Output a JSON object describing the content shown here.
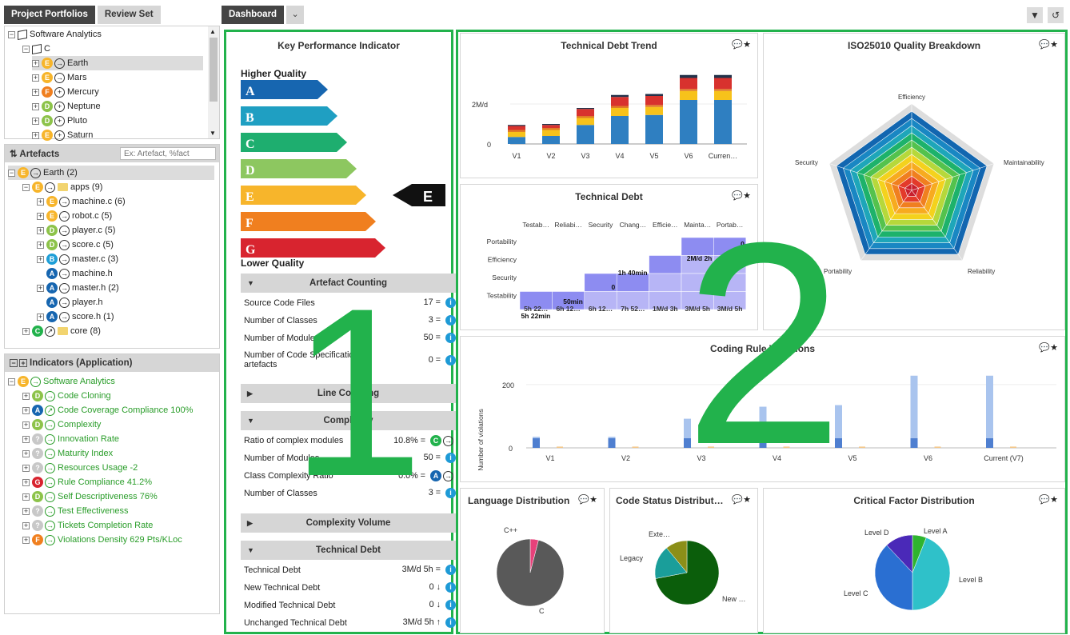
{
  "tabs": {
    "project_portfolios": "Project Portfolios",
    "review_set": "Review Set",
    "dashboard": "Dashboard"
  },
  "portfolio_tree": [
    {
      "label": "Software Analytics",
      "pm": "−",
      "icon": "cube"
    },
    {
      "label": "C",
      "pm": "−",
      "icon": "cube"
    },
    {
      "label": "Earth",
      "pm": "+",
      "badge": "E",
      "arrow": "→",
      "selected": true
    },
    {
      "label": "Mars",
      "pm": "+",
      "badge": "E",
      "arrow": "→"
    },
    {
      "label": "Mercury",
      "pm": "+",
      "badge": "F",
      "arrow": "+"
    },
    {
      "label": "Neptune",
      "pm": "+",
      "badge": "D",
      "arrow": "+"
    },
    {
      "label": "Pluto",
      "pm": "+",
      "badge": "D",
      "arrow": "+"
    },
    {
      "label": "Saturn",
      "pm": "+",
      "badge": "E",
      "arrow": "+"
    }
  ],
  "artefacts": {
    "title": "Artefacts",
    "search_placeholder": "Ex: Artefact, %fact",
    "items": [
      {
        "label": "Earth (2)",
        "pm": "−",
        "badge": "E",
        "indent": 0,
        "folder": false,
        "selected": true
      },
      {
        "label": "apps (9)",
        "pm": "−",
        "badge": "E",
        "indent": 1,
        "folder": true
      },
      {
        "label": "machine.c (6)",
        "pm": "+",
        "badge": "E",
        "indent": 2
      },
      {
        "label": "robot.c (5)",
        "pm": "+",
        "badge": "E",
        "indent": 2
      },
      {
        "label": "player.c (5)",
        "pm": "+",
        "badge": "D",
        "indent": 2
      },
      {
        "label": "score.c (5)",
        "pm": "+",
        "badge": "D",
        "indent": 2
      },
      {
        "label": "master.c (3)",
        "pm": "+",
        "badge": "B",
        "indent": 2
      },
      {
        "label": "machine.h",
        "pm": "",
        "badge": "A",
        "indent": 2
      },
      {
        "label": "master.h (2)",
        "pm": "+",
        "badge": "A",
        "indent": 2
      },
      {
        "label": "player.h",
        "pm": "",
        "badge": "A",
        "indent": 2
      },
      {
        "label": "score.h (1)",
        "pm": "+",
        "badge": "A",
        "indent": 2
      },
      {
        "label": "core (8)",
        "pm": "+",
        "badge": "C",
        "indent": 1,
        "folder": true,
        "arrow": "↗"
      }
    ]
  },
  "indicators": {
    "title": "Indicators (Application)",
    "items": [
      {
        "label": "Software Analytics",
        "pm": "−",
        "badge": "E",
        "indent": 0
      },
      {
        "label": "Code Cloning",
        "badge": "D"
      },
      {
        "label": "Code Coverage Compliance 100%",
        "badge": "A",
        "arrow": "↗"
      },
      {
        "label": "Complexity",
        "badge": "D"
      },
      {
        "label": "Innovation Rate",
        "badge": "?"
      },
      {
        "label": "Maturity Index",
        "badge": "?"
      },
      {
        "label": "Resources Usage -2",
        "badge": "?"
      },
      {
        "label": "Rule Compliance 41.2%",
        "badge": "G"
      },
      {
        "label": "Self Descriptiveness 76%",
        "badge": "D"
      },
      {
        "label": "Test Effectiveness",
        "badge": "?"
      },
      {
        "label": "Tickets Completion Rate",
        "badge": "?"
      },
      {
        "label": "Violations Density 629 Pts/KLoc",
        "badge": "F"
      }
    ]
  },
  "kpi": {
    "title": "Key Performance Indicator",
    "higher": "Higher Quality",
    "lower": "Lower Quality",
    "current": "E",
    "grades": [
      {
        "l": "A",
        "c": "#1766b0"
      },
      {
        "l": "B",
        "c": "#1f9fc2"
      },
      {
        "l": "C",
        "c": "#1eae6f"
      },
      {
        "l": "D",
        "c": "#8dc760"
      },
      {
        "l": "E",
        "c": "#f7b52b"
      },
      {
        "l": "F",
        "c": "#f07f1f"
      },
      {
        "l": "G",
        "c": "#d8242f"
      }
    ],
    "sections": [
      {
        "title": "Artefact Counting",
        "open": true,
        "rows": [
          {
            "label": "Source Code Files",
            "value": "17 ="
          },
          {
            "label": "Number of Classes",
            "value": "3 ="
          },
          {
            "label": "Number of Modules",
            "value": "50 ="
          },
          {
            "label": "Number of Code Specification artefacts",
            "value": "0 ="
          }
        ]
      },
      {
        "title": "Line Counting",
        "open": false,
        "rows": []
      },
      {
        "title": "Complexity",
        "open": true,
        "rows": [
          {
            "label": "Ratio of complex modules",
            "value": "10.8% =",
            "badge": "C"
          },
          {
            "label": "Number of Modules",
            "value": "50 ="
          },
          {
            "label": "Class Complexity Ratio",
            "value": "0.0% =",
            "badge": "A"
          },
          {
            "label": "Number of Classes",
            "value": "3 ="
          }
        ]
      },
      {
        "title": "Complexity Volume",
        "open": false,
        "rows": []
      },
      {
        "title": "Technical Debt",
        "open": true,
        "rows": [
          {
            "label": "Technical Debt",
            "value": "3M/d 5h ="
          },
          {
            "label": "New Technical Debt",
            "value": "0 ↓"
          },
          {
            "label": "Modified Technical Debt",
            "value": "0 ↓"
          },
          {
            "label": "Unchanged Technical Debt",
            "value": "3M/d 5h ↑"
          }
        ]
      }
    ]
  },
  "cards": {
    "trend": {
      "title": "Technical Debt Trend",
      "ytick_top": "2M/d",
      "ytick_zero": "0"
    },
    "iso": {
      "title": "ISO25010 Quality Breakdown",
      "axes": [
        "Efficiency",
        "Maintainability",
        "Reliability",
        "Portability",
        "Security"
      ]
    },
    "debt": {
      "title": "Technical Debt",
      "cols": [
        "Testab…",
        "Reliabi…",
        "Security",
        "Chang…",
        "Efficie…",
        "Mainta…",
        "Portab…"
      ],
      "rows": [
        "Portability",
        "Efficiency",
        "Security",
        "Testability"
      ],
      "bottom": [
        "5h 22…",
        "6h 12…",
        "6h 12…",
        "7h 52…",
        "1M/d 3h",
        "3M/d 5h",
        "3M/d 5h"
      ],
      "labels": [
        "0",
        "2M/d 2h",
        "1h 40min",
        "0",
        "50min",
        "5h 22min"
      ]
    },
    "rules": {
      "title": "Coding Rule Violations",
      "ylabel": "Number of violations",
      "ytick": "200",
      "yzero": "0"
    },
    "lang": {
      "title": "Language Distribution"
    },
    "status": {
      "title": "Code Status Distribut…"
    },
    "critical": {
      "title": "Critical Factor Distribution"
    }
  },
  "chart_data": [
    {
      "type": "bar",
      "title": "Technical Debt Trend",
      "categories": [
        "V1",
        "V2",
        "V3",
        "V4",
        "V5",
        "V6",
        "Curren…"
      ],
      "stacked": true,
      "ylabel": "",
      "ylim": [
        0,
        3.8
      ],
      "series": [
        {
          "color": "#2f7fc1",
          "values": [
            0.35,
            0.4,
            0.95,
            1.4,
            1.45,
            2.2,
            2.2
          ]
        },
        {
          "color": "#f7c21b",
          "values": [
            0.25,
            0.3,
            0.35,
            0.4,
            0.4,
            0.45,
            0.45
          ]
        },
        {
          "color": "#e07b27",
          "values": [
            0.1,
            0.1,
            0.1,
            0.1,
            0.1,
            0.1,
            0.1
          ]
        },
        {
          "color": "#d8322e",
          "values": [
            0.2,
            0.15,
            0.35,
            0.45,
            0.45,
            0.55,
            0.55
          ]
        },
        {
          "color": "#23324a",
          "values": [
            0.05,
            0.05,
            0.05,
            0.1,
            0.1,
            0.15,
            0.15
          ]
        }
      ]
    },
    {
      "type": "bar",
      "title": "Coding Rule Violations",
      "categories": [
        "V1",
        "V2",
        "V3",
        "V4",
        "V5",
        "V6",
        "Current (V7)"
      ],
      "ylabel": "Number of violations",
      "ylim": [
        0,
        240
      ],
      "series": [
        {
          "color": "#a9c4ee",
          "values": [
            35,
            35,
            92,
            130,
            135,
            228,
            228
          ]
        },
        {
          "color": "#f4c78a",
          "values": [
            4,
            4,
            4,
            4,
            4,
            4,
            4
          ]
        }
      ]
    },
    {
      "type": "pie",
      "title": "Language Distribution",
      "labels": [
        "C++",
        "C"
      ],
      "values": [
        4,
        96
      ],
      "colors": [
        "#e8417a",
        "#595959"
      ]
    },
    {
      "type": "pie",
      "title": "Code Status Distribut…",
      "labels": [
        "New …",
        "Legacy",
        "Exte…"
      ],
      "values": [
        72,
        17,
        11
      ],
      "colors": [
        "#0b5e0b",
        "#1a9e9a",
        "#8b8f18"
      ]
    },
    {
      "type": "pie",
      "title": "Critical Factor Distribution",
      "labels": [
        "Level A",
        "Level B",
        "Level C",
        "Level D"
      ],
      "values": [
        6,
        44,
        38,
        12
      ],
      "colors": [
        "#2fb42f",
        "#2fc1c9",
        "#2a6fd2",
        "#4a29b8"
      ]
    }
  ]
}
